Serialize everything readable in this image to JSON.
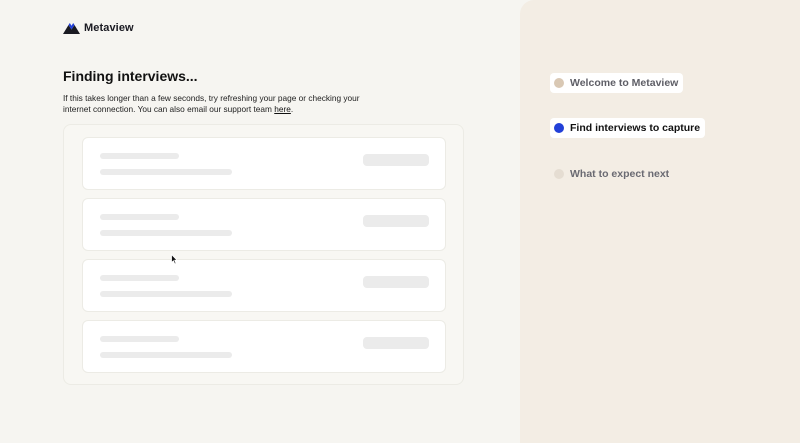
{
  "brand": {
    "name": "Metaview"
  },
  "main": {
    "title": "Finding interviews...",
    "help_text_before": "If this takes longer than a few seconds, try refreshing your page or checking your internet connection. You can also email our support team ",
    "help_link": "here",
    "help_text_after": "."
  },
  "skeleton_cards": 4,
  "steps": [
    {
      "label": "Welcome to Metaview",
      "state": "done",
      "dot_color": "#d9c8b4",
      "text_color": "#5e5e66"
    },
    {
      "label": "Find interviews to capture",
      "state": "current",
      "dot_color": "#2240d8",
      "text_color": "#111111"
    },
    {
      "label": "What to expect next",
      "state": "upcoming",
      "dot_color": "#e5ddd2",
      "text_color": "#6a6a72"
    }
  ],
  "colors": {
    "accent": "#2240d8",
    "left_background": "#f6f5f1",
    "right_background": "#f3ede4"
  }
}
